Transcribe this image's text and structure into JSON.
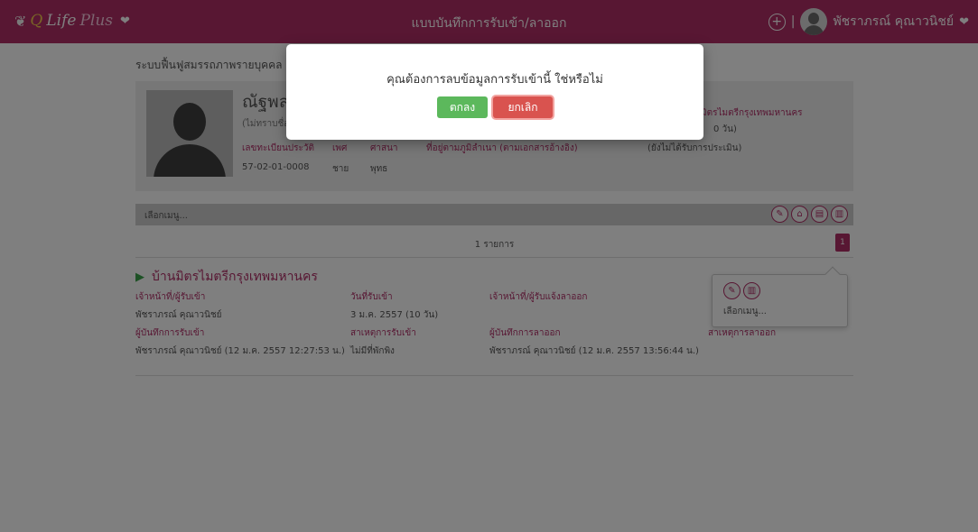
{
  "topbar": {
    "brand": {
      "q": "Q",
      "life": "Life",
      "plus": "Plus"
    },
    "title": "แบบบันทึกการรับเข้า/ลาออก",
    "user_name": "พัชราภรณ์ คุณาวนิชย์",
    "color": "#b02e67"
  },
  "system_title": "ระบบฟื้นฟูสมรรถภาพรายบุคคล",
  "profile": {
    "name": "ณัฐพล",
    "unknown_note": "(ไม่ทราบชื่อ",
    "center_right": "มิตรไมตรีกรุงเทพมหานคร",
    "center_days": "0 วัน)",
    "labels": {
      "record_id": "เลขทะเบียนประวัติ",
      "sex": "เพศ",
      "religion": "ศาสนา",
      "address": "ที่อยู่ตามภูมิลำเนา (ตามเอกสารอ้างอิง)",
      "assessment": "(ยังไม่ได้รับการประเมิน)"
    },
    "values": {
      "record_id": "57-02-01-0008",
      "sex": "ชาย",
      "religion": "พุทธ"
    }
  },
  "menu": {
    "label": "เลือกเมนู..."
  },
  "list": {
    "count": "1 รายการ",
    "page": "1"
  },
  "record": {
    "center": "บ้านมิตรไมตรีกรุงเทพมหานคร",
    "labels": {
      "admit_officer": "เจ้าหน้าที่/ผู้รับเข้า",
      "admit_date": "วันที่รับเข้า",
      "leave_officer": "เจ้าหน้าที่/ผู้รับแจ้งลาออก",
      "admit_recorder": "ผู้บันทึกการรับเข้า",
      "admit_reason": "สาเหตุการรับเข้า",
      "leave_recorder": "ผู้บันทึกการลาออก",
      "leave_reason": "สาเหตุการลาออก"
    },
    "values": {
      "admit_officer": "พัชราภรณ์ คุณาวนิชย์",
      "admit_date": "3 ม.ค. 2557 (10 วัน)",
      "admit_recorder": "พัชราภรณ์ คุณาวนิชย์ (12 ม.ค. 2557 12:27:53 น.)",
      "admit_reason": "ไม่มีที่พักพิง",
      "leave_recorder": "พัชราภรณ์ คุณาวนิชย์ (12 ม.ค. 2557 13:56:44 น.)"
    },
    "popover_menu": "เลือกเมนู..."
  },
  "dialog": {
    "message": "คุณต้องการลบข้อมูลการรับเข้านี้ ใช่หรือไม่",
    "ok_label": "ตกลง",
    "cancel_label": "ยกเลิก"
  }
}
